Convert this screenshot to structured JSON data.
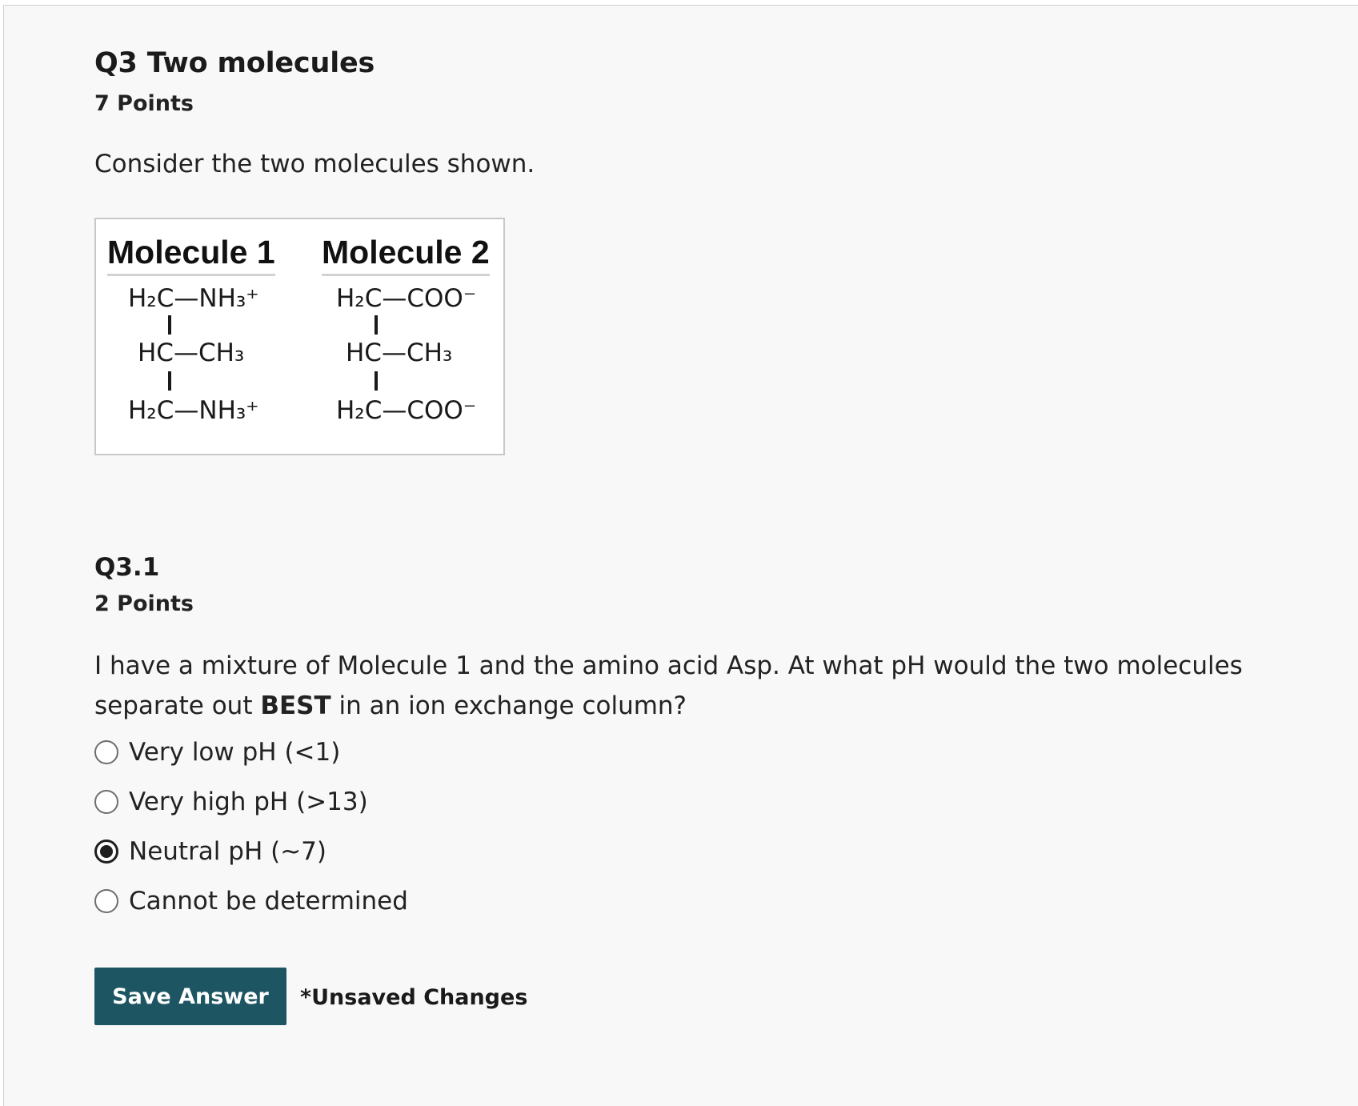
{
  "question": {
    "title": "Q3 Two molecules",
    "points": "7 Points",
    "prompt": "Consider the two molecules shown."
  },
  "figure": {
    "molecule1": {
      "heading": "Molecule 1",
      "line1": "H₂C—NH₃⁺",
      "line2": "HC—CH₃",
      "line3": "H₂C—NH₃⁺"
    },
    "molecule2": {
      "heading": "Molecule 2",
      "line1": "H₂C—COO⁻",
      "line2": "HC—CH₃",
      "line3": "H₂C—COO⁻"
    }
  },
  "subquestion": {
    "title": "Q3.1",
    "points": "2 Points",
    "text_before": "I have a mixture of Molecule 1 and the amino acid Asp. At what pH would the two molecules separate out ",
    "text_bold": "BEST",
    "text_after": " in an ion exchange column?",
    "options": [
      {
        "label": "Very low pH (<1)",
        "selected": false
      },
      {
        "label": "Very high pH (>13)",
        "selected": false
      },
      {
        "label": "Neutral pH (~7)",
        "selected": true
      },
      {
        "label": "Cannot be determined",
        "selected": false
      }
    ]
  },
  "actions": {
    "save_label": "Save Answer",
    "status": "*Unsaved Changes"
  },
  "colors": {
    "save_button": "#1d5662",
    "panel_background": "#f8f8f8"
  }
}
